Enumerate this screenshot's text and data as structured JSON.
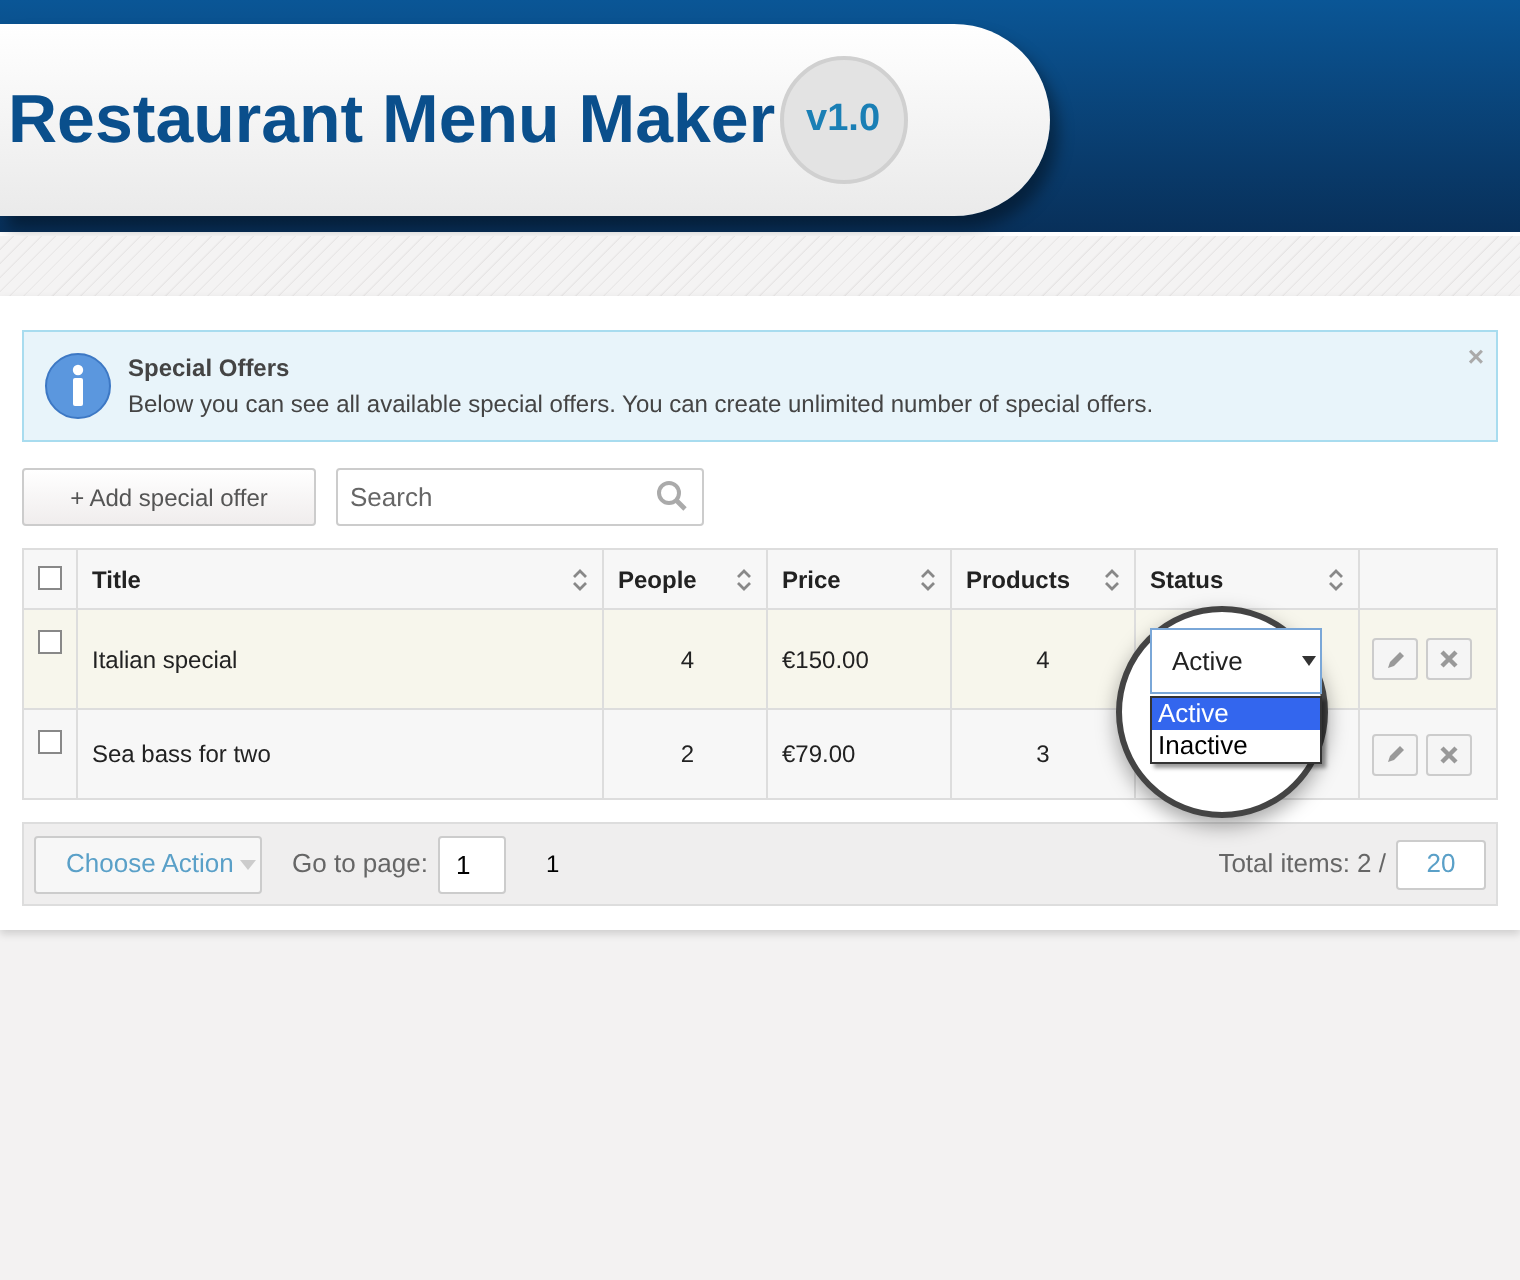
{
  "header": {
    "title": "Restaurant Menu Maker",
    "version": "v1.0"
  },
  "notice": {
    "title": "Special Offers",
    "text": "Below you can see all available special offers. You can create unlimited number of special offers.",
    "close": "×"
  },
  "toolbar": {
    "add_button": "+ Add special offer",
    "search": {
      "placeholder": "Search"
    }
  },
  "table": {
    "header_checkbox": {
      "checked": false
    },
    "columns": [
      {
        "label": "Title"
      },
      {
        "label": "People"
      },
      {
        "label": "Price"
      },
      {
        "label": "Products"
      },
      {
        "label": "Status"
      }
    ],
    "rows": [
      {
        "checked": false,
        "highlighted": true,
        "cells": [
          "Italian special",
          "4",
          "€150.00",
          "4"
        ],
        "status": "Active",
        "status_open": true,
        "options": [
          {
            "label": "Active",
            "selected": true
          },
          {
            "label": "Inactive",
            "selected": false
          }
        ]
      },
      {
        "checked": false,
        "highlighted": false,
        "cells": [
          "Sea bass for two",
          "2",
          "€79.00",
          "3"
        ],
        "status_open": false
      }
    ]
  },
  "footer": {
    "action": "Choose Action",
    "goto_label": "Go to page:",
    "page": "1",
    "page_count": "1",
    "total": "Total items: 2 /",
    "per_page": "20"
  }
}
